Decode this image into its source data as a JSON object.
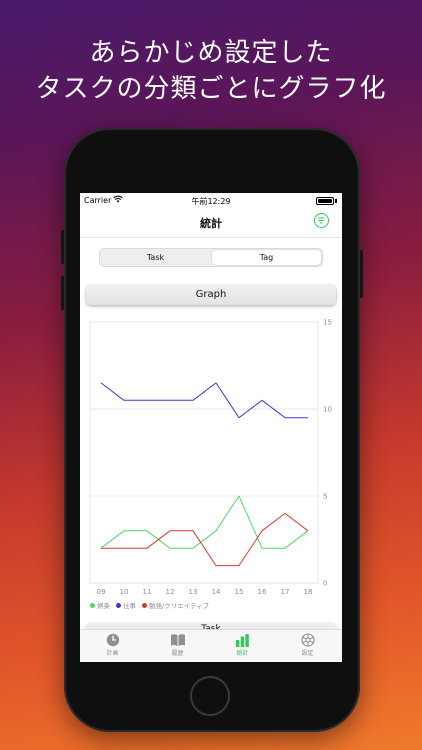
{
  "headline": {
    "line1": "あらかじめ設定した",
    "line2": "タスクの分類ごとにグラフ化"
  },
  "status_bar": {
    "carrier": "Carrier",
    "time": "午前12:29"
  },
  "nav": {
    "title": "統計",
    "filter_icon": "filter-icon"
  },
  "segmented_control": {
    "options": [
      "Task",
      "Tag"
    ],
    "selected": "Tag"
  },
  "graph_button": {
    "label": "Graph"
  },
  "chart_data": {
    "type": "line",
    "categories": [
      "09",
      "10",
      "11",
      "12",
      "13",
      "14",
      "15",
      "16",
      "17",
      "18"
    ],
    "ylim": [
      0,
      15
    ],
    "yticks": [
      "0",
      "5",
      "10",
      "15"
    ],
    "grid": true,
    "series": [
      {
        "name": "仕事",
        "color": "#3b3bd1",
        "values": [
          11.5,
          10.5,
          10.5,
          10.5,
          10.5,
          11.5,
          9.5,
          10.5,
          9.5,
          9.5
        ]
      },
      {
        "name": "娯楽",
        "color": "#4cd964",
        "values": [
          2,
          3,
          3,
          2,
          2,
          3,
          5,
          2,
          2,
          3
        ]
      },
      {
        "name": "勉強/クリエイティブ",
        "color": "#e5332a",
        "values": [
          2,
          2,
          2,
          3,
          3,
          1,
          1,
          3,
          4,
          3
        ]
      }
    ],
    "legend_position": "bottom-left"
  },
  "peek_button": {
    "label": "Task"
  },
  "tab_bar": {
    "items": [
      {
        "label": "計画",
        "icon": "clock-icon"
      },
      {
        "label": "履歴",
        "icon": "book-icon"
      },
      {
        "label": "統計",
        "icon": "chart-icon",
        "active": true
      },
      {
        "label": "設定",
        "icon": "settings-icon"
      }
    ]
  }
}
